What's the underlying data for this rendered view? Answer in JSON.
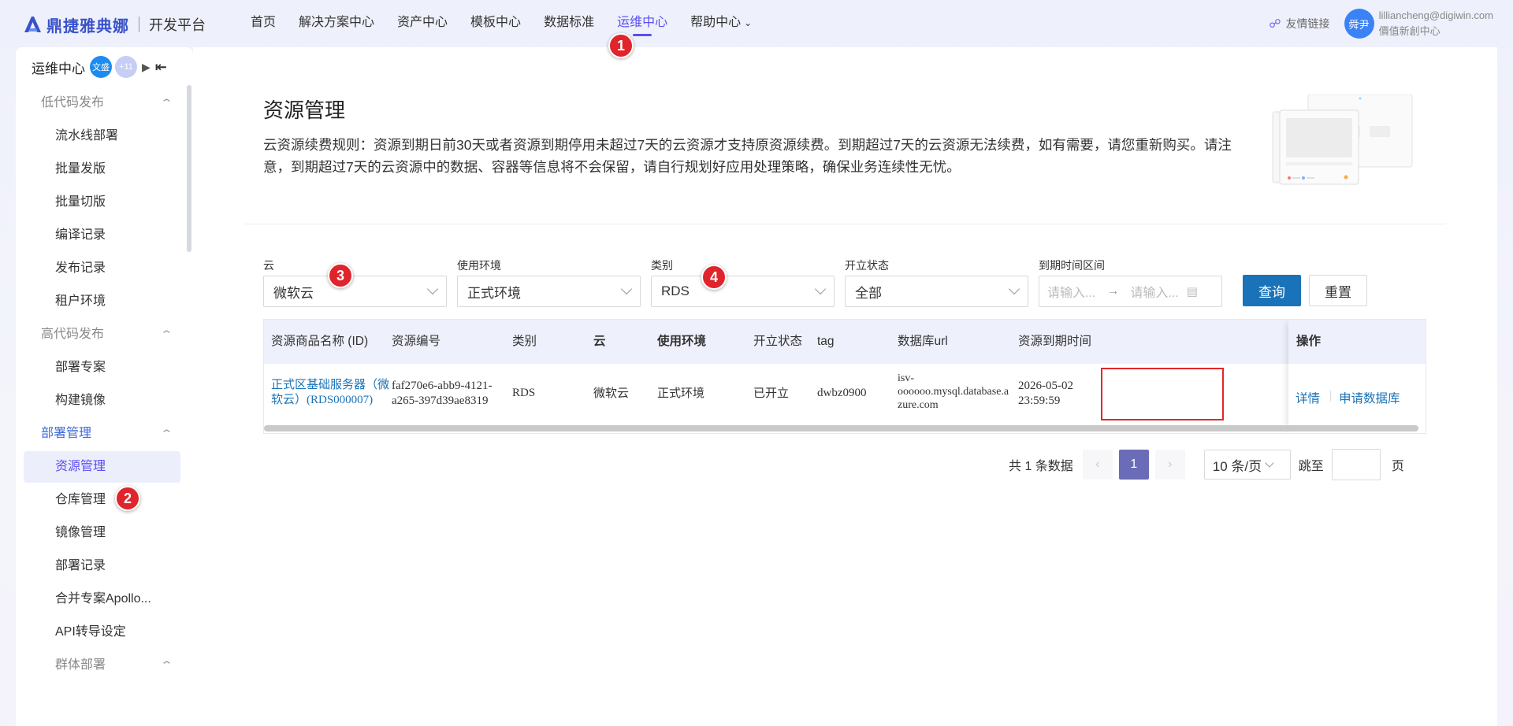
{
  "header": {
    "brand": "鼎捷雅典娜",
    "platform": "开发平台",
    "nav": [
      {
        "label": "首页"
      },
      {
        "label": "解决方案中心"
      },
      {
        "label": "资产中心"
      },
      {
        "label": "模板中心"
      },
      {
        "label": "数据标准"
      },
      {
        "label": "运维中心",
        "active": true
      },
      {
        "label": "帮助中心"
      }
    ],
    "friend_link": "友情链接",
    "avatar_text": "舜尹",
    "user_email": "lilliancheng@digiwin.com",
    "user_org": "價值新創中心"
  },
  "sidebar": {
    "title": "运维中心",
    "badge_1": "文盛",
    "badge_2": "+11",
    "groups": [
      {
        "label": "低代码发布",
        "items": [
          "流水线部署",
          "批量发版",
          "批量切版",
          "编译记录",
          "发布记录",
          "租户环境"
        ]
      },
      {
        "label": "高代码发布",
        "items": [
          "部署专案",
          "构建镜像"
        ]
      },
      {
        "label": "部署管理",
        "items": [
          "资源管理",
          "仓库管理",
          "镜像管理",
          "部署记录",
          "合并专案Apollo...",
          "API转导设定"
        ]
      },
      {
        "label": "群体部署",
        "items": []
      }
    ],
    "active_item": "资源管理"
  },
  "page": {
    "title": "资源管理",
    "rule": "云资源续费规则：资源到期日前30天或者资源到期停用未超过7天的云资源才支持原资源续费。到期超过7天的云资源无法续费，如有需要，请您重新购买。请注意，到期超过7天的云资源中的数据、容器等信息将不会保留，请自行规划好应用处理策略，确保业务连续性无忧。"
  },
  "filters": {
    "cloud": {
      "label": "云",
      "value": "微软云"
    },
    "env": {
      "label": "使用环境",
      "value": "正式环境"
    },
    "type": {
      "label": "类别",
      "value": "RDS"
    },
    "status": {
      "label": "开立状态",
      "value": "全部"
    },
    "expire": {
      "label": "到期时间区间",
      "start_placeholder": "请输入...",
      "end_placeholder": "请输入..."
    },
    "query_button": "查询",
    "reset_button": "重置"
  },
  "table": {
    "columns": [
      "资源商品名称 (ID)",
      "资源编号",
      "类别",
      "云",
      "使用环境",
      "开立状态",
      "tag",
      "数据库url",
      "资源到期时间",
      "操作"
    ],
    "rows": [
      {
        "name_line1": "正式区基础服务器（微",
        "name_line2": "软云）(RDS000007)",
        "code_line1": "faf270e6-abb9-4121-",
        "code_line2": "a265-397d39ae8319",
        "type": "RDS",
        "cloud": "微软云",
        "env": "正式环境",
        "status": "已开立",
        "tag": "dwbz0900",
        "url_line1": "isv-",
        "url_line2": "oooooo.mysql.database.a",
        "url_line3": "zure.com",
        "expire_line1": "2026-05-02",
        "expire_line2": "23:59:59",
        "op_detail": "详情",
        "op_apply": "申请数据库"
      }
    ]
  },
  "pagination": {
    "total_text": "共 1 条数据",
    "current_page": "1",
    "page_size": "10 条/页",
    "jump_label": "跳至",
    "page_suffix": "页"
  },
  "markers": [
    "1",
    "2",
    "3",
    "4"
  ],
  "colors": {
    "accent": "#5a4ff0",
    "primary_button": "#1a73b8",
    "link": "#1a73b8",
    "marker": "#e0242b",
    "highlight_box": "#e3262b"
  }
}
